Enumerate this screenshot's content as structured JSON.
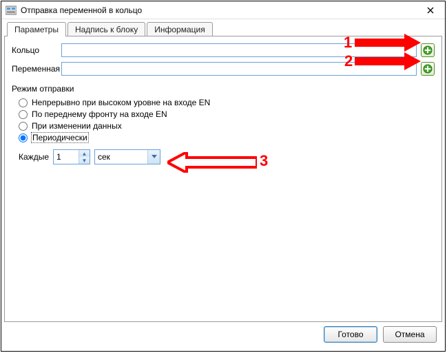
{
  "window": {
    "title": "Отправка переменной в кольцо"
  },
  "tabs": {
    "parameters": "Параметры",
    "caption": "Надпись к блоку",
    "info": "Информация"
  },
  "fields": {
    "ring_label": "Кольцо",
    "ring_value": "",
    "variable_label": "Переменная",
    "variable_value": ""
  },
  "mode": {
    "heading": "Режим отправки",
    "opt_continuous": "Непрерывно при высоком уровне на входе EN",
    "opt_rising": "По переднему фронту на входе EN",
    "opt_onchange": "При изменении данных",
    "opt_periodic": "Периодически"
  },
  "interval": {
    "every_label": "Каждые",
    "value": "1",
    "unit": "сек"
  },
  "buttons": {
    "ok": "Готово",
    "cancel": "Отмена"
  },
  "annotations": {
    "a1": "1",
    "a2": "2",
    "a3": "3"
  }
}
